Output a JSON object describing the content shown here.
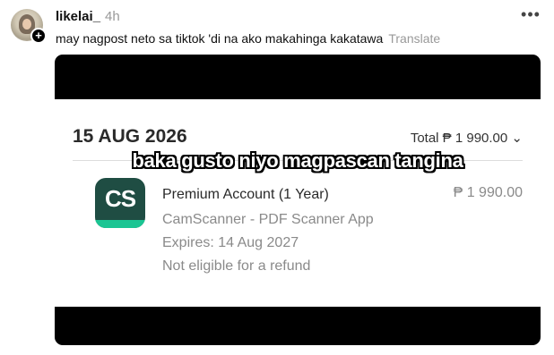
{
  "post": {
    "username": "likelai_",
    "time": "4h",
    "caption": "may nagpost neto sa tiktok 'di na ako makahinga kakatawa",
    "translate_label": "Translate",
    "more_glyph": "•••",
    "follow_glyph": "+"
  },
  "receipt": {
    "date": "15 AUG 2026",
    "total": "Total ₱ 1 990.00",
    "total_chevron": "⌄",
    "overlay_text": "baka gusto niyo magpascan tangina",
    "app_icon_text": "CS",
    "product": "Premium Account (1 Year)",
    "price": "₱ 1 990.00",
    "app_name": "CamScanner - PDF Scanner App",
    "expires": "Expires: 14 Aug 2027",
    "refund": "Not eligible for a refund"
  },
  "colors": {
    "icon_bg": "#1f4d43",
    "icon_stripe": "#1bc593",
    "muted": "#999999"
  }
}
